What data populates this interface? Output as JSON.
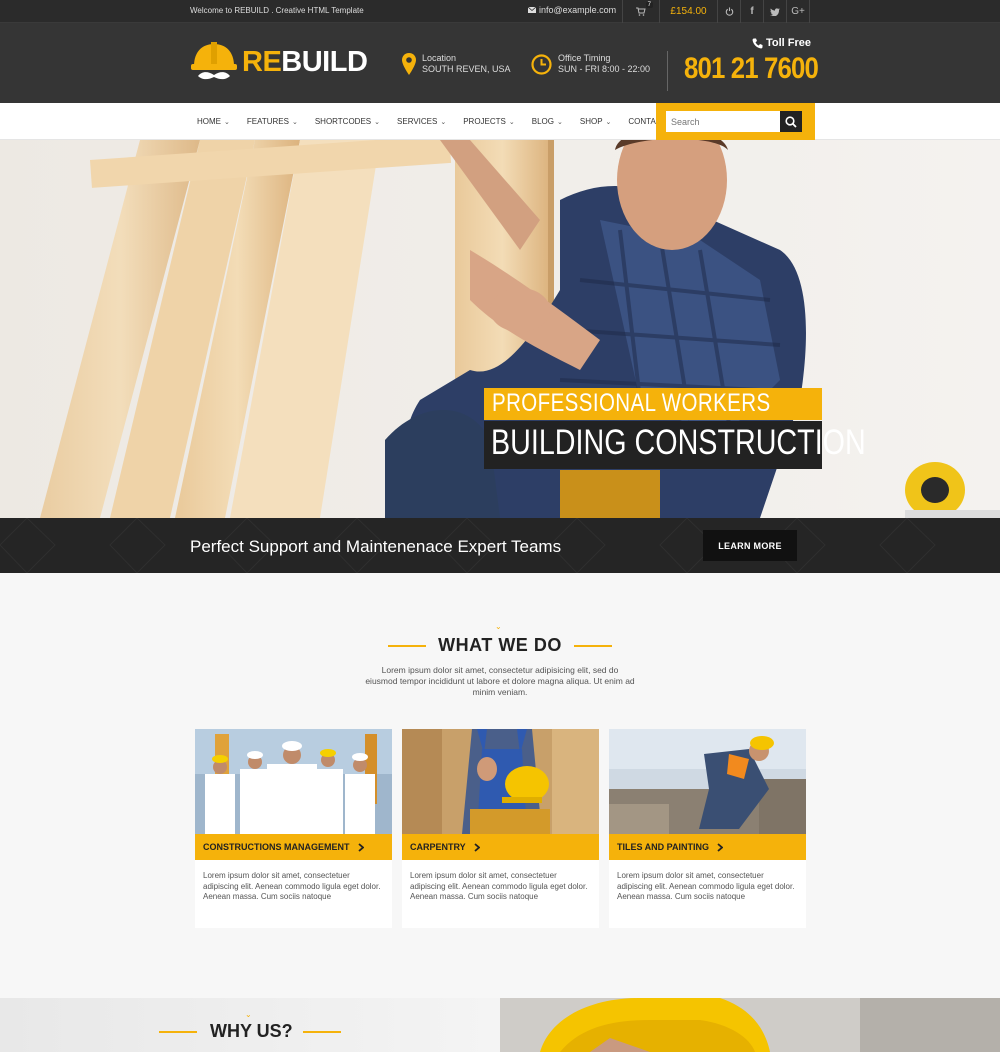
{
  "topbar": {
    "welcome": "Welcome to REBUILD . Creative HTML Template",
    "email": "info@example.com",
    "cart_count": "7",
    "price": "£154.00",
    "icons": [
      "power-icon",
      "facebook-icon",
      "twitter-icon",
      "google-plus-icon"
    ]
  },
  "header": {
    "logo_re": "RE",
    "logo_build": "BUILD",
    "location_label": "Location",
    "location_value": "SOUTH REVEN, USA",
    "timing_label": "Office Timing",
    "timing_value": "SUN - FRI 8:00 - 22:00",
    "tollfree": "Toll Free",
    "phone": "801 21 7600"
  },
  "nav": {
    "items": [
      "HOME",
      "FEATURES",
      "SHORTCODES",
      "SERVICES",
      "PROJECTS",
      "BLOG",
      "SHOP",
      "CONTACT US"
    ],
    "search_placeholder": "Search"
  },
  "hero": {
    "caption_top": "PROFESSIONAL WORKERS",
    "caption_bottom": "BUILDING CONSTRUCTION"
  },
  "strip": {
    "text": "Perfect Support and Maintenenace Expert Teams",
    "button": "LEARN MORE"
  },
  "what_we_do": {
    "title": "WHAT WE DO",
    "description": "Lorem ipsum dolor sit amet, consectetur adipisicing elit, sed do eiusmod tempor incididunt ut labore et dolore magna aliqua. Ut enim ad minim veniam.",
    "cards": [
      {
        "title": "CONSTRUCTIONS MANAGEMENT",
        "text": "Lorem ipsum dolor sit amet, consectetuer adipiscing elit. Aenean commodo ligula eget dolor. Aenean massa. Cum sociis natoque"
      },
      {
        "title": "CARPENTRY",
        "text": "Lorem ipsum dolor sit amet, consectetuer adipiscing elit. Aenean commodo ligula eget dolor. Aenean massa. Cum sociis natoque"
      },
      {
        "title": "TILES AND PAINTING",
        "text": "Lorem ipsum dolor sit amet, consectetuer adipiscing elit. Aenean commodo ligula eget dolor. Aenean massa. Cum sociis natoque"
      }
    ]
  },
  "why_us": {
    "title": "WHY US?"
  },
  "colors": {
    "accent": "#f5b20b",
    "dark": "#353535",
    "darker": "#252525"
  }
}
